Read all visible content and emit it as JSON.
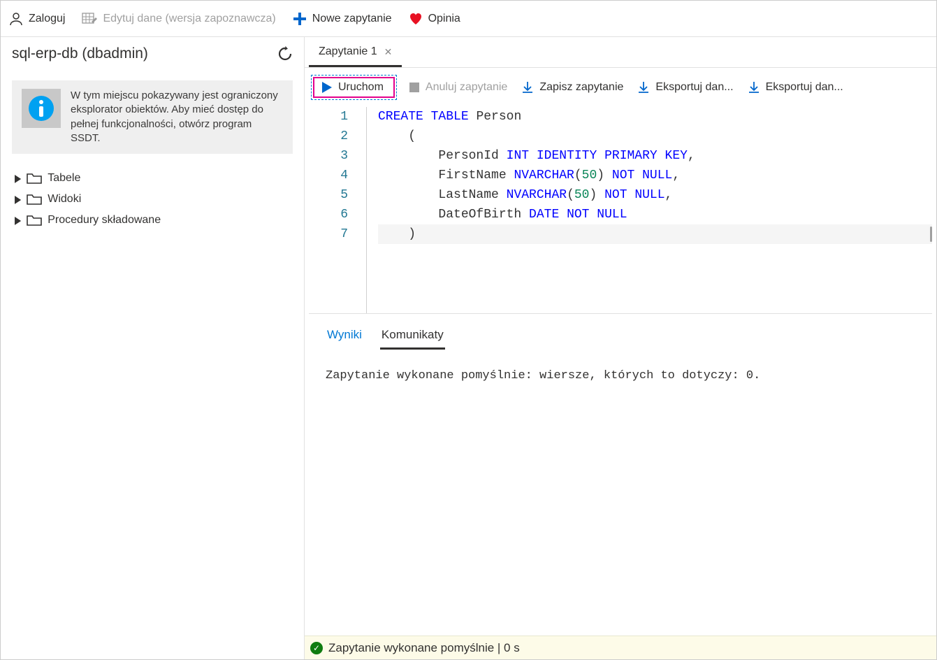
{
  "topbar": {
    "login": "Zaloguj",
    "edit_data": "Edytuj dane (wersja zapoznawcza)",
    "new_query": "Nowe zapytanie",
    "feedback": "Opinia"
  },
  "sidebar": {
    "title": "sql-erp-db (dbadmin)",
    "info_text": "W tym miejscu pokazywany jest ograniczony eksplorator obiektów. Aby mieć dostęp do pełnej funkcjonalności, otwórz program SSDT.",
    "tree": [
      {
        "label": "Tabele"
      },
      {
        "label": "Widoki"
      },
      {
        "label": "Procedury składowane"
      }
    ]
  },
  "tabs": {
    "query1": "Zapytanie 1"
  },
  "actions": {
    "run": "Uruchom",
    "cancel": "Anuluj zapytanie",
    "save": "Zapisz zapytanie",
    "export1": "Eksportuj dan...",
    "export2": "Eksportuj dan..."
  },
  "editor": {
    "code_lines": [
      {
        "n": "1",
        "tokens": [
          [
            "kw",
            "CREATE"
          ],
          [
            " ",
            " "
          ],
          [
            "kw",
            "TABLE"
          ],
          [
            " ",
            " "
          ],
          [
            "tx",
            "Person"
          ]
        ]
      },
      {
        "n": "2",
        "tokens": [
          [
            "tx",
            "    ("
          ]
        ]
      },
      {
        "n": "3",
        "tokens": [
          [
            "tx",
            "        PersonId "
          ],
          [
            "kw",
            "INT"
          ],
          [
            " ",
            " "
          ],
          [
            "kw",
            "IDENTITY"
          ],
          [
            " ",
            " "
          ],
          [
            "kw",
            "PRIMARY"
          ],
          [
            " ",
            " "
          ],
          [
            "kw",
            "KEY"
          ],
          [
            "tx",
            ","
          ]
        ]
      },
      {
        "n": "4",
        "tokens": [
          [
            "tx",
            "        FirstName "
          ],
          [
            "kw",
            "NVARCHAR"
          ],
          [
            "tx",
            "("
          ],
          [
            "num",
            "50"
          ],
          [
            "tx",
            ")"
          ],
          [
            " ",
            " "
          ],
          [
            "kw",
            "NOT"
          ],
          [
            " ",
            " "
          ],
          [
            "kw",
            "NULL"
          ],
          [
            "tx",
            ","
          ]
        ]
      },
      {
        "n": "5",
        "tokens": [
          [
            "tx",
            "        LastName "
          ],
          [
            "kw",
            "NVARCHAR"
          ],
          [
            "tx",
            "("
          ],
          [
            "num",
            "50"
          ],
          [
            "tx",
            ")"
          ],
          [
            " ",
            " "
          ],
          [
            "kw",
            "NOT"
          ],
          [
            " ",
            " "
          ],
          [
            "kw",
            "NULL"
          ],
          [
            "tx",
            ","
          ]
        ]
      },
      {
        "n": "6",
        "tokens": [
          [
            "tx",
            "        DateOfBirth "
          ],
          [
            "kw",
            "DATE"
          ],
          [
            " ",
            " "
          ],
          [
            "kw",
            "NOT"
          ],
          [
            " ",
            " "
          ],
          [
            "kw",
            "NULL"
          ]
        ]
      },
      {
        "n": "7",
        "tokens": [
          [
            "tx",
            "    )"
          ]
        ]
      }
    ],
    "current_line": 7
  },
  "results": {
    "tab_results": "Wyniki",
    "tab_messages": "Komunikaty",
    "message": "Zapytanie wykonane pomyślnie: wiersze, których to dotyczy: 0."
  },
  "statusbar": {
    "text": "Zapytanie wykonane pomyślnie | 0 s"
  },
  "colors": {
    "accent_blue": "#0078d4",
    "accent_pink": "#e3008c",
    "keyword_blue": "#0000ff",
    "number_green": "#098658",
    "status_green": "#107c10",
    "heart_red": "#e81123"
  }
}
